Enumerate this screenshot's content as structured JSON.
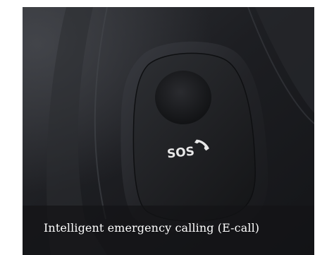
{
  "photo": {
    "subject": "SOS emergency call button on car ceiling console",
    "button_text": "SOS",
    "icon": "phone-handset-icon"
  },
  "caption": {
    "text": "Intelligent emergency calling (E-call)"
  },
  "colors": {
    "background": "#ffffff",
    "console_dark": "#1c1d20",
    "caption_bar": "rgba(20,20,22,0.72)",
    "caption_text": "#ffffff",
    "label_text": "#e8e8e8"
  }
}
